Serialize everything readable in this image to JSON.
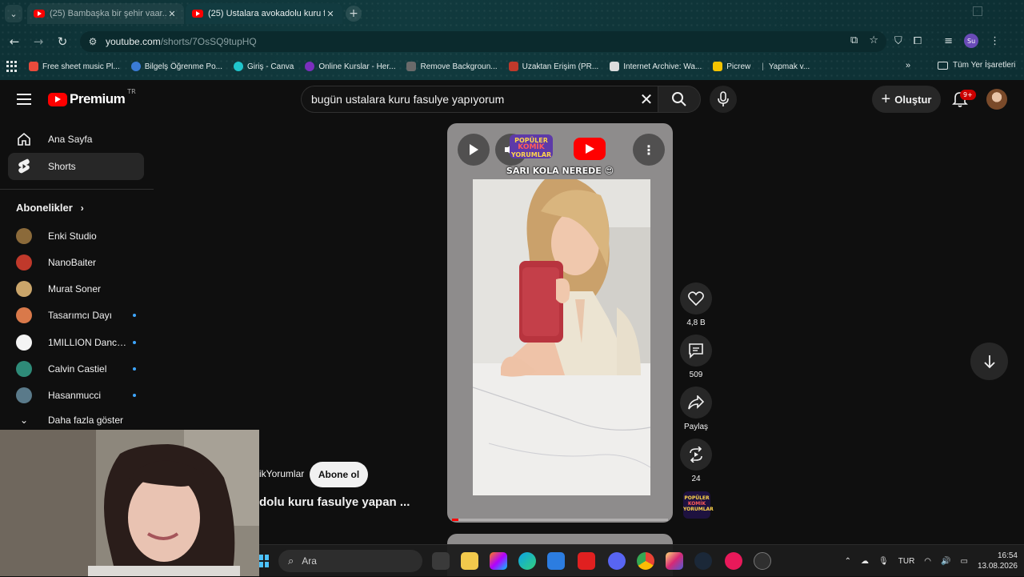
{
  "browser": {
    "tabs": [
      {
        "title": "(25) Bambaşka bir şehir vaar...",
        "active": false
      },
      {
        "title": "(25) Ustalara avokadolu kuru fa",
        "active": true
      }
    ],
    "url_host": "youtube.com",
    "url_path": "/shorts/7OsSQ9tupHQ",
    "profile_initials": "Su",
    "bookmarks": [
      {
        "label": "Free sheet music Pl...",
        "color": "#e84b3c"
      },
      {
        "label": "Bilgelş Öğrenme Po...",
        "color": "#3a7bd5"
      },
      {
        "label": "Giriş - Canva",
        "color": "#20c4cb"
      },
      {
        "label": "Online Kurslar - Her...",
        "color": "#7b2fbe"
      },
      {
        "label": "Remove Backgroun...",
        "color": "#6a6a6a"
      },
      {
        "label": "Uzaktan Erişim (PR...",
        "color": "#c0392b"
      },
      {
        "label": "Internet Archive: Wa...",
        "color": "#dddddd"
      },
      {
        "label": "Picrew",
        "color": "#f4c400"
      },
      {
        "label": "Yapmak v...",
        "color": "#555555"
      }
    ],
    "all_bookmarks": "Tüm Yer İşaretleri"
  },
  "youtube": {
    "logo_text": "Premium",
    "logo_sup": "TR",
    "search_query": "bugün ustalara kuru fasulye yapıyorum",
    "create_label": "Oluştur",
    "notification_count": "9+"
  },
  "sidebar": {
    "nav": [
      {
        "label": "Ana Sayfa",
        "icon": "home-icon"
      },
      {
        "label": "Shorts",
        "icon": "shorts-icon",
        "active": true
      }
    ],
    "subscriptions_title": "Abonelikler",
    "subscriptions": [
      {
        "name": "Enki Studio",
        "color": "#8b6a3a",
        "live": false
      },
      {
        "name": "NanoBaiter",
        "color": "#c0392b",
        "live": false
      },
      {
        "name": "Murat Soner",
        "color": "#caa56a",
        "live": false
      },
      {
        "name": "Tasarımcı Dayı",
        "color": "#d9794a",
        "live": true
      },
      {
        "name": "1MILLION Dance...",
        "color": "#f4f4f4",
        "live": true
      },
      {
        "name": "Calvin Castiel",
        "color": "#2e8b78",
        "live": true
      },
      {
        "name": "Hasanmucci",
        "color": "#5a7a8a",
        "live": true
      }
    ],
    "show_more": "Daha fazla göster"
  },
  "short": {
    "caption": "SARI KOLA NEREDE 😍",
    "channel_logo": [
      "POPÜLER",
      "KOMİK",
      "YORUMLAR"
    ],
    "progress": 0.03,
    "likes": "4,8 B",
    "comments": "509",
    "share": "Paylaş",
    "remixes": "24",
    "channel_name": "ikYorumlar",
    "subscribe_label": "Abone ol",
    "title": "dolu kuru fasulye yapan ..."
  },
  "taskbar": {
    "search_placeholder": "Ara",
    "language": "TUR",
    "time": "16:54",
    "date": "13.08.2026"
  }
}
